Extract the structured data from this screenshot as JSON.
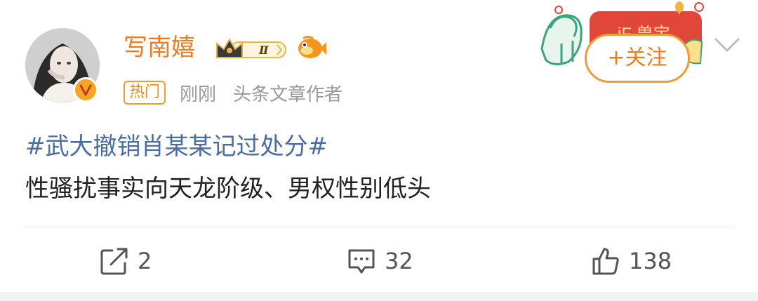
{
  "user": {
    "name": "写南嬉",
    "crown_level": "Ⅱ"
  },
  "meta": {
    "hot_tag": "热门",
    "time": "刚刚",
    "source": "头条文章作者"
  },
  "follow": {
    "label": "+关注"
  },
  "festival_banner": {
    "text": "iF 兽宝"
  },
  "post": {
    "topic": "#武大撤销肖某某记过处分#",
    "text": "性骚扰事实向天龙阶级、男权性别低头"
  },
  "actions": {
    "repost_count": "2",
    "comment_count": "32",
    "like_count": "138"
  },
  "colors": {
    "accent": "#f07a1e",
    "topic_link": "#4a6da0",
    "festival_green": "#3aa57a",
    "festival_red": "#e0463a"
  }
}
